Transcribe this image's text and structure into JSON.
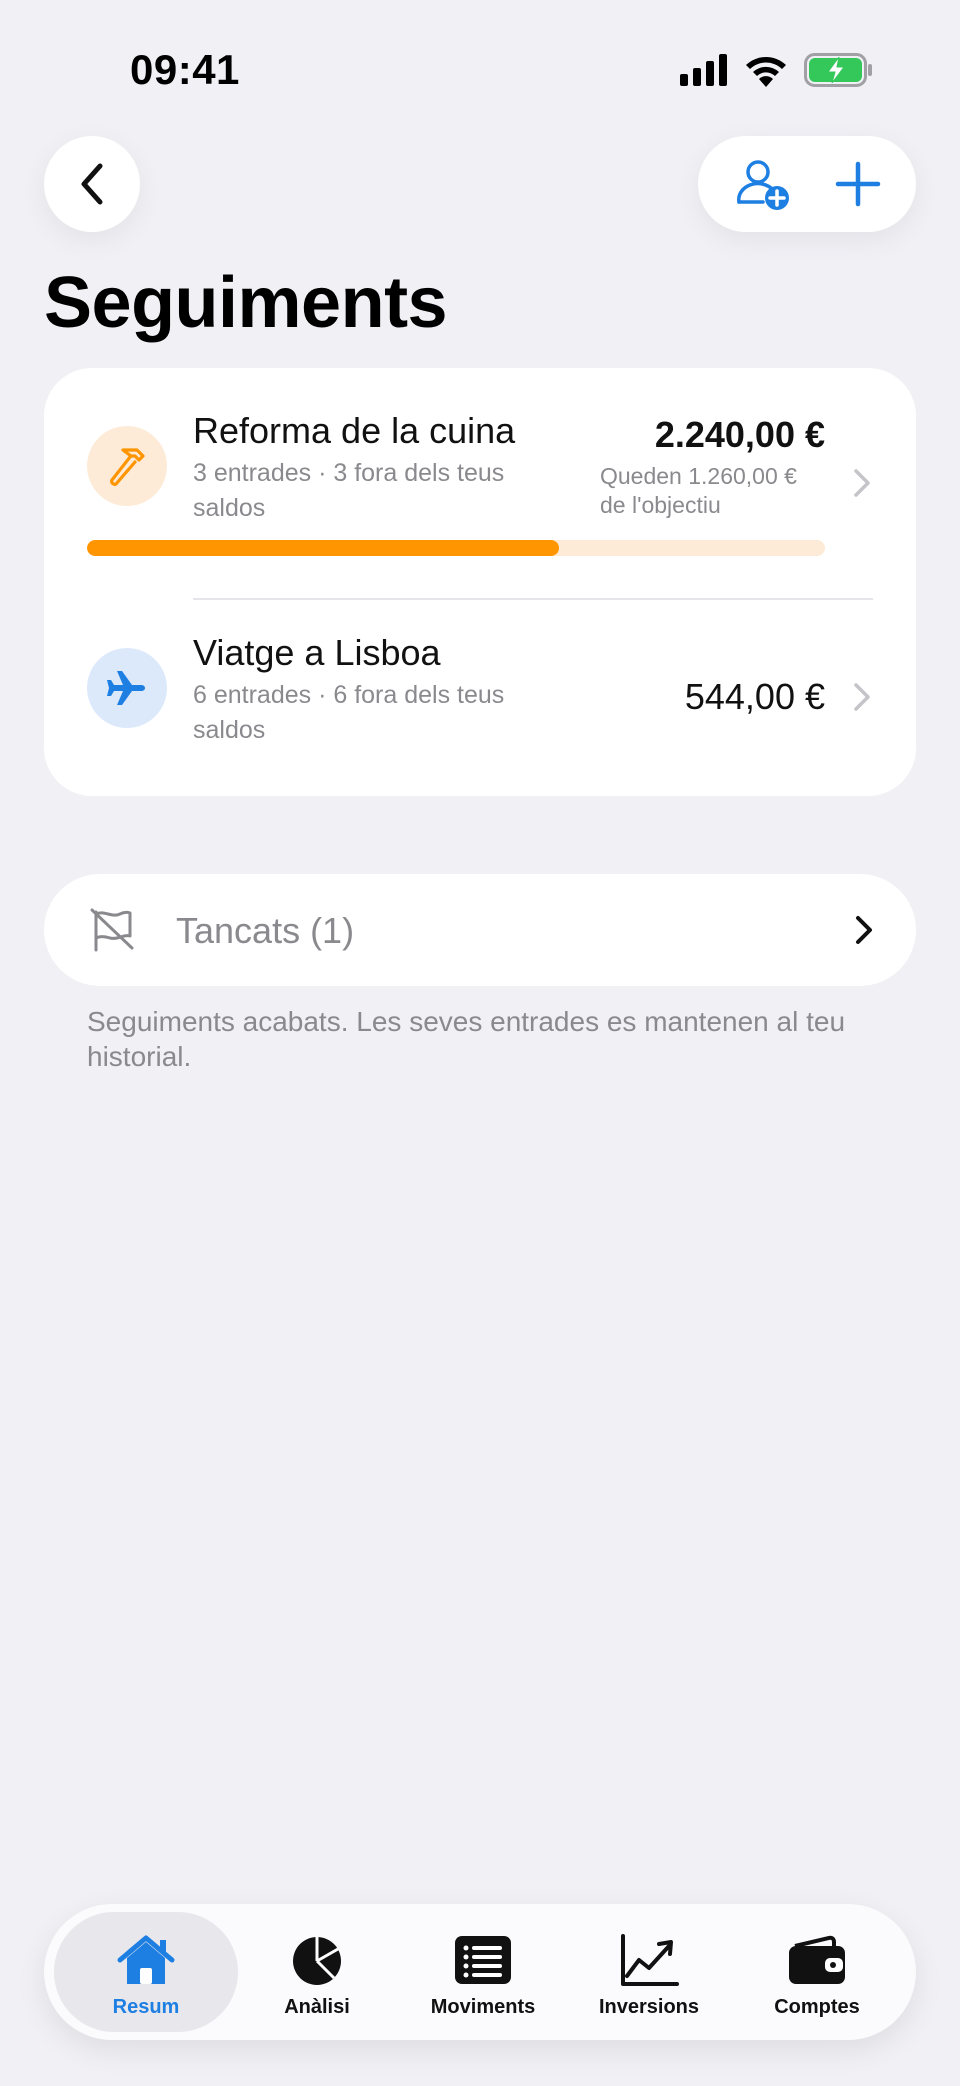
{
  "status_bar": {
    "time": "09:41",
    "icons": [
      "signal-icon",
      "wifi-icon",
      "battery-charging-icon"
    ]
  },
  "header": {
    "back_icon": "chevron-left-icon",
    "add_person_icon": "person-add-icon",
    "add_icon": "plus-icon",
    "title": "Seguiments"
  },
  "trackings": [
    {
      "icon": "hammer-icon",
      "icon_color": "#ff9500",
      "title": "Reforma de la cuina",
      "subtitle": "3 entrades · 3 fora dels teus saldos",
      "amount": "2.240,00 €",
      "goal_note": "Queden 1.260,00 € de l'objectiu",
      "progress": 0.64
    },
    {
      "icon": "airplane-icon",
      "icon_color": "#1e7fe3",
      "title": "Viatge a Lisboa",
      "subtitle": "6 entrades · 6 fora dels teus saldos",
      "amount": "544,00 €"
    }
  ],
  "closed": {
    "icon": "flag-slash-icon",
    "label": "Tancats (1)",
    "note": "Seguiments acabats. Les seves entrades es mantenen al teu historial."
  },
  "tab_bar": {
    "active": "Resum",
    "tabs": [
      {
        "label": "Resum",
        "icon": "house-icon"
      },
      {
        "label": "Anàlisi",
        "icon": "pie-chart-icon"
      },
      {
        "label": "Moviments",
        "icon": "list-icon"
      },
      {
        "label": "Inversions",
        "icon": "chart-line-icon"
      },
      {
        "label": "Comptes",
        "icon": "wallet-icon"
      }
    ]
  },
  "colors": {
    "accent": "#1e7fe3",
    "orange": "#ff9500",
    "background": "#f0f0f5",
    "secondary_text": "#8a8a8e"
  }
}
